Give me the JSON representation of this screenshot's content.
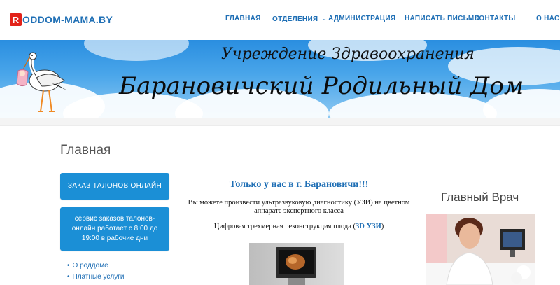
{
  "header": {
    "logo_letter": "R",
    "logo_text": "ODDOM-MAMA.BY",
    "nav": [
      {
        "label": "ГЛАВНАЯ"
      },
      {
        "label": "ОТДЕЛЕНИЯ",
        "icon": "chevron-down-icon"
      },
      {
        "label": "АДМИНИСТРАЦИЯ"
      },
      {
        "label": "НАПИСАТЬ ПИСЬМО"
      },
      {
        "label": "КОНТАКТЫ"
      },
      {
        "label": "О НАС"
      }
    ]
  },
  "banner": {
    "line1": "Учреждение Здравоохранения",
    "line2": "Барановичский Родильный Дом",
    "icon": "stork-icon"
  },
  "main": {
    "title": "Главная",
    "button_order": "ЗАКАЗ ТАЛОНОВ ОНЛАЙН",
    "button_service": "сервис заказов талонов-онлайн работает с 8:00 до 19:00 в рабочие дни",
    "links": [
      {
        "label": "О роддоме"
      },
      {
        "label": "Платные услуги"
      }
    ],
    "heading": "Только у нас в г. Барановичи!!!",
    "text": "Вы  можете произвести ультразвуковую диагностику (УЗИ) на цветном аппарате экспертного класса",
    "text_3d_prefix": "Цифровая трехмерная реконструкция плода  (",
    "text_3d_highlight": "3D УЗИ",
    "text_3d_suffix": ")",
    "doctor_title": "Главный Врач"
  },
  "colors": {
    "brand_blue": "#1f6fb5",
    "button_blue": "#1b8fd6",
    "logo_red": "#e2231a"
  }
}
